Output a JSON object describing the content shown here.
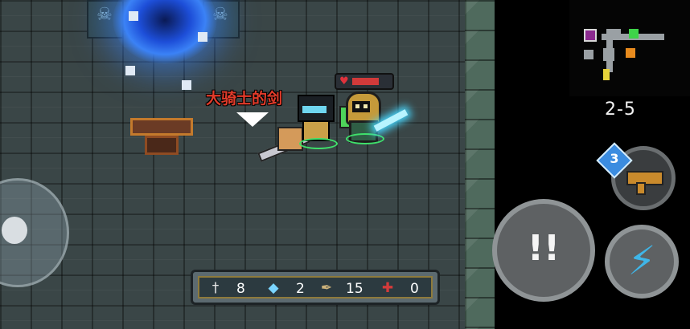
{
  "world": {
    "dropped_weapon_name": "大骑士的剑"
  },
  "resources": {
    "weapons_count": "8",
    "gems_count": "2",
    "materials_count": "15",
    "parts_count": "0"
  },
  "hud": {
    "level": "2-5",
    "swap_ammo": "3",
    "attack_symbol": "!!",
    "skill_symbol": "⚡"
  },
  "player": {
    "hp_fraction": 0.55
  },
  "icons": {
    "weapon": "sword-icon",
    "gem": "gem-icon",
    "material": "feather-icon",
    "part": "cross-icon",
    "attack": "attack-icon",
    "skill": "lightning-icon",
    "swap": "rifle-icon"
  },
  "colors": {
    "weapon_label": "#e23b2a",
    "portal": "#3b82f6",
    "skill": "#3fb6e8",
    "minimap_current_room": "#3ed449",
    "minimap_chest_room": "#e88b1e",
    "minimap_shop_room": "#8b2a8f"
  }
}
